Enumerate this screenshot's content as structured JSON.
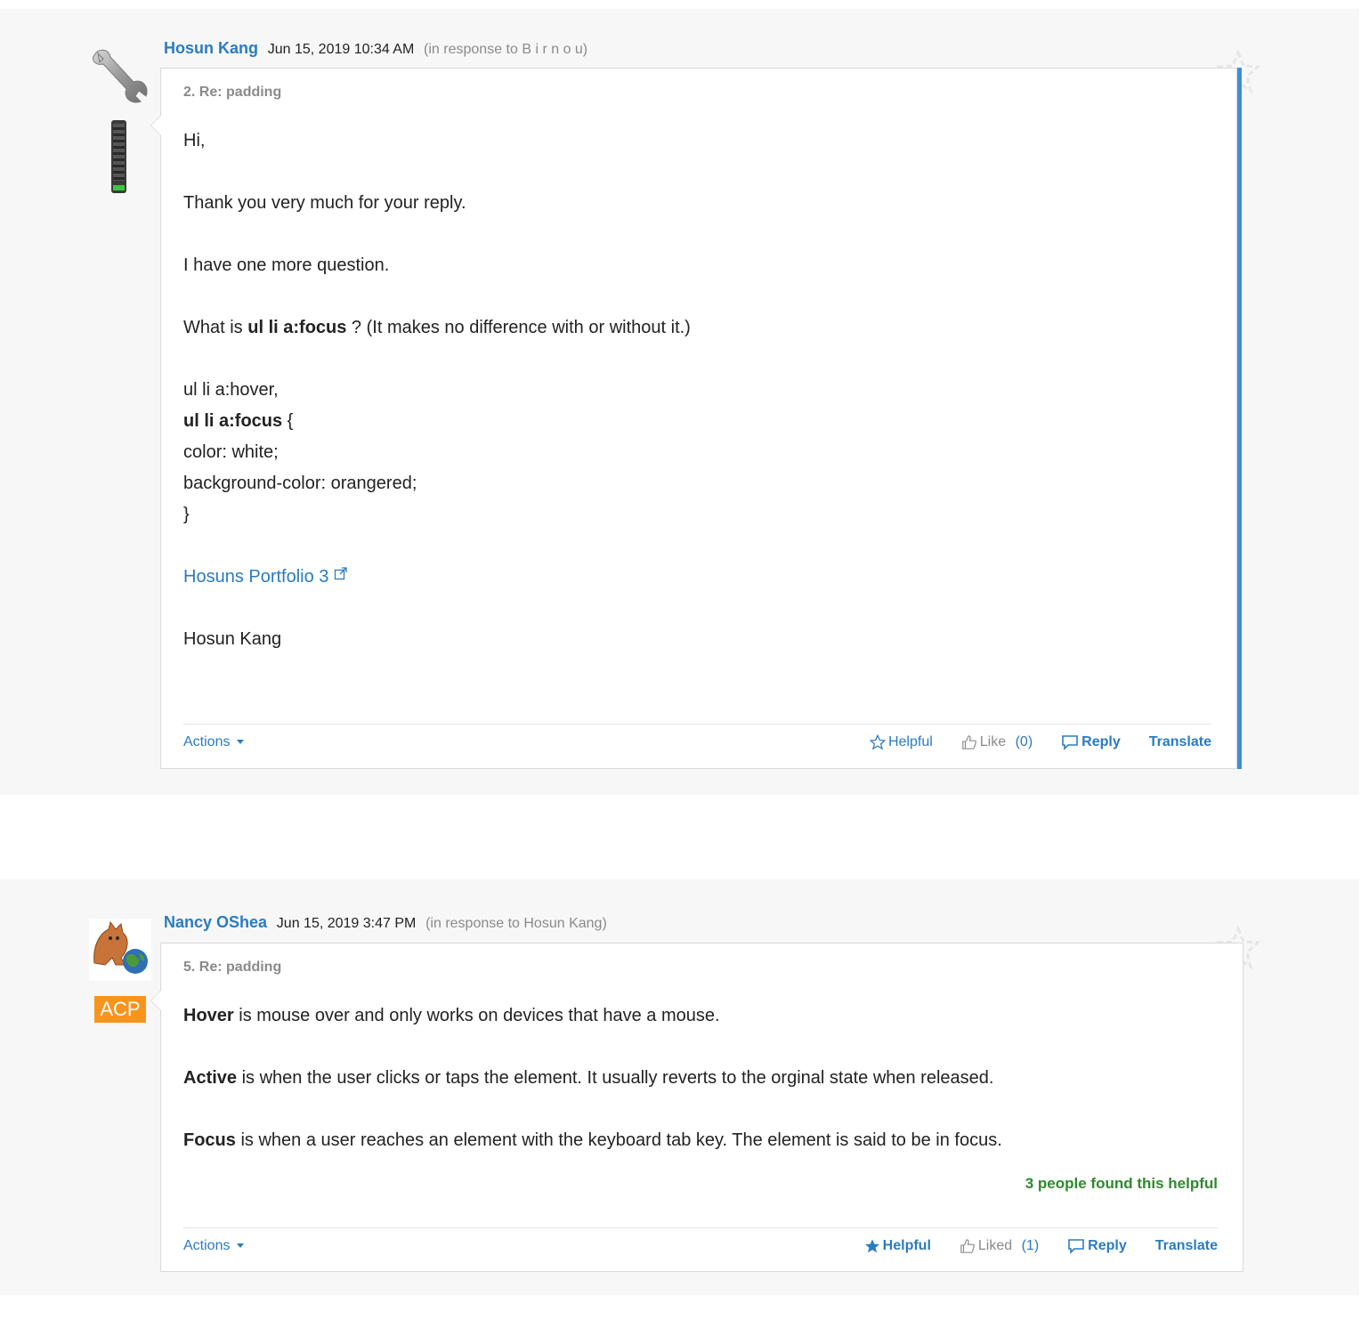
{
  "posts": [
    {
      "author": "Hosun Kang",
      "date": "Jun 15, 2019 10:34 AM",
      "in_response": "(in response to B i r n o u)",
      "subject": "2. Re: padding",
      "avatar_icon": "wrench-icon",
      "body": {
        "p1": "Hi,",
        "p2": "Thank you very much for your reply.",
        "p3": "I have one more question.",
        "p4_pre": "What is ",
        "p4_bold": "ul li a:focus",
        "p4_post": " ? (It makes no difference with or without it.)",
        "code1": "ul li a:hover,",
        "code2_bold": "ul li a:focus",
        "code2_post": " {",
        "code3": "color: white;",
        "code4": "background-color: orangered;",
        "code5": "}",
        "link": "Hosuns Portfolio 3",
        "signature": "Hosun Kang"
      },
      "actions": {
        "menu": "Actions",
        "helpful": "Helpful",
        "like": "Like",
        "like_count": "(0)",
        "reply": "Reply",
        "translate": "Translate"
      }
    },
    {
      "author": "Nancy OShea",
      "date": "Jun 15, 2019 3:47 PM",
      "in_response": "(in response to Hosun Kang)",
      "subject": "5. Re: padding",
      "badge": "ACP",
      "body": {
        "l1_bold": "Hover",
        "l1_rest": " is mouse over and only works on devices that have a mouse.",
        "l2_bold": "Active",
        "l2_rest": " is when the user clicks or taps the element.  It usually reverts to the orginal state when released.",
        "l3_bold": "Focus",
        "l3_rest": " is when a user reaches an element with the keyboard tab key. The element is said to be in focus."
      },
      "helpful_note": "3 people found this helpful",
      "actions": {
        "menu": "Actions",
        "helpful": "Helpful",
        "like": "Liked",
        "like_count": "(1)",
        "reply": "Reply",
        "translate": "Translate"
      }
    }
  ],
  "colors": {
    "link": "#2b7bbf",
    "helpful_green": "#2d8a2d",
    "acp_orange": "#f7941d",
    "accent_blue": "#3d8fd6"
  }
}
